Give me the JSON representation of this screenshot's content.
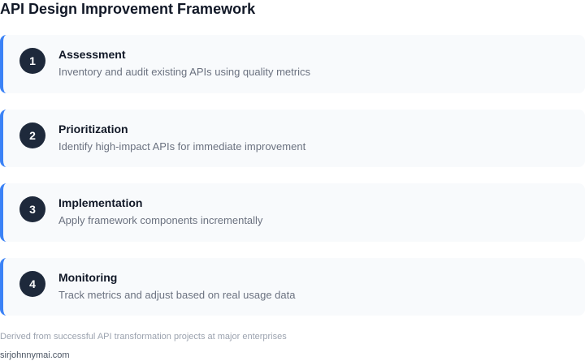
{
  "title": "API Design Improvement Framework",
  "steps": [
    {
      "number": "1",
      "title": "Assessment",
      "description": "Inventory and audit existing APIs using quality metrics"
    },
    {
      "number": "2",
      "title": "Prioritization",
      "description": "Identify high-impact APIs for immediate improvement"
    },
    {
      "number": "3",
      "title": "Implementation",
      "description": "Apply framework components incrementally"
    },
    {
      "number": "4",
      "title": "Monitoring",
      "description": "Track metrics and adjust based on real usage data"
    }
  ],
  "footnote": "Derived from successful API transformation projects at major enterprises",
  "credit": "sirjohnnymai.com",
  "colors": {
    "accent": "#3b82f6",
    "badge": "#1e293b",
    "card_background": "#f8fafc"
  }
}
